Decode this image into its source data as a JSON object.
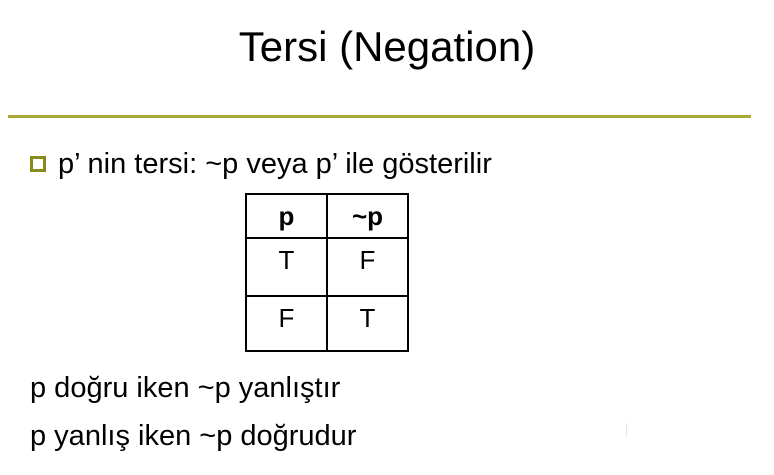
{
  "slide": {
    "title": "Tersi (Negation)",
    "accent_color": "#a9a93a",
    "bullet_color": "#8a8a1a"
  },
  "bullet": {
    "icon": "hollow-square-bullet-icon",
    "text": "p’ nin tersi: ~p veya  p’ ile gösterilir"
  },
  "truth_table": {
    "headers": [
      "p",
      "~p"
    ],
    "rows": [
      [
        "T",
        "F"
      ],
      [
        "F",
        "T"
      ]
    ]
  },
  "statements": [
    "p doğru iken ~p yanlıştır",
    "p yanlış iken ~p doğrudur"
  ]
}
